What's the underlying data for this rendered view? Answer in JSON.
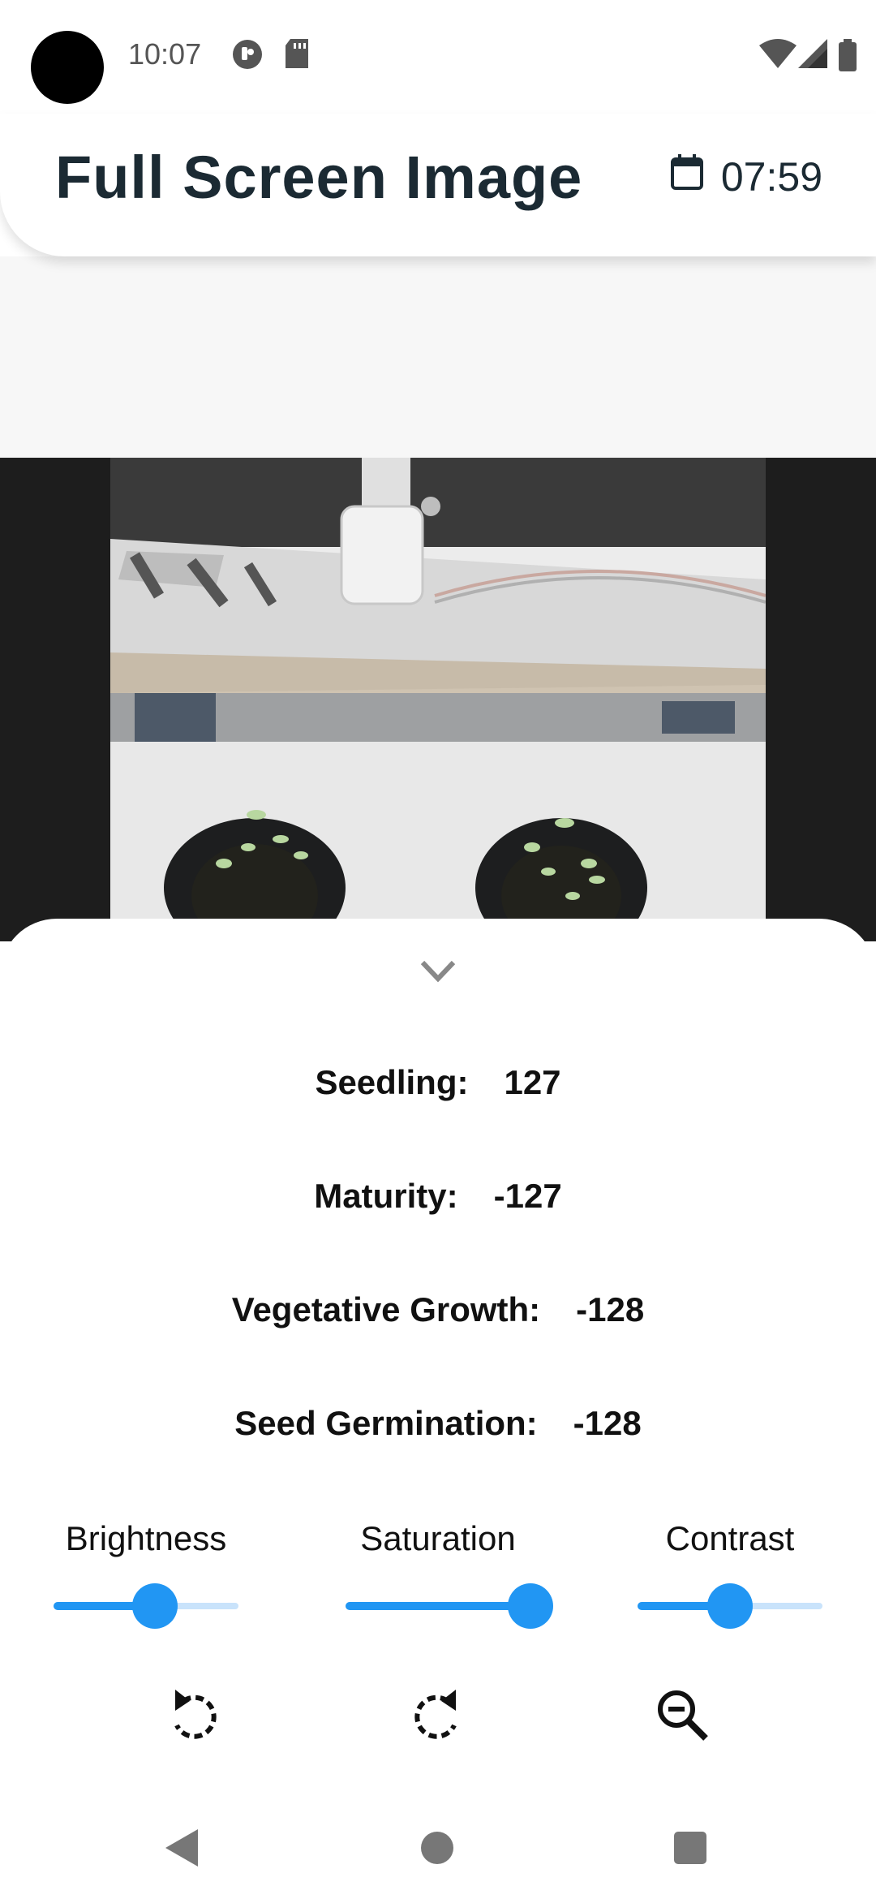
{
  "status_bar": {
    "time": "10:07",
    "left_icons": [
      "app-badge-icon",
      "sd-card-icon"
    ],
    "right_icons": [
      "wifi-icon",
      "signal-icon",
      "battery-icon"
    ]
  },
  "header": {
    "title": "Full Screen Image",
    "date_icon": "calendar-icon",
    "time": "07:59"
  },
  "image": {
    "description_icon": "plant-camera-photo"
  },
  "stats": [
    {
      "label": "Seedling:",
      "value": "127"
    },
    {
      "label": "Maturity:",
      "value": "-127"
    },
    {
      "label": "Vegetative Growth:",
      "value": "-128"
    },
    {
      "label": "Seed Germination:",
      "value": "-128"
    }
  ],
  "sliders": [
    {
      "label": "Brightness",
      "value": 0.55
    },
    {
      "label": "Saturation",
      "value": 1.0
    },
    {
      "label": "Contrast",
      "value": 0.5
    }
  ],
  "actions": [
    "rotate-left-icon",
    "rotate-right-icon",
    "zoom-out-icon"
  ],
  "colors": {
    "accent": "#2196f3",
    "accent_light": "#c9e3fb",
    "title": "#1b2a33"
  },
  "nav": [
    "back-icon",
    "home-icon",
    "recents-icon"
  ]
}
